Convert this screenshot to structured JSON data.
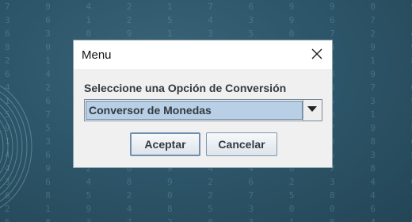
{
  "dialog": {
    "title": "Menu",
    "prompt": "Seleccione una Opción de Conversión",
    "selected_option": "Conversor de Monedas",
    "ok_label": "Aceptar",
    "cancel_label": "Cancelar"
  },
  "icons": {
    "close": "close-icon",
    "dropdown": "chevron-down-icon"
  },
  "colors": {
    "background": "#2b4f62",
    "dialog_bg": "#f0f0f0",
    "selection": "#b8cfe5",
    "text": "#333a40"
  }
}
